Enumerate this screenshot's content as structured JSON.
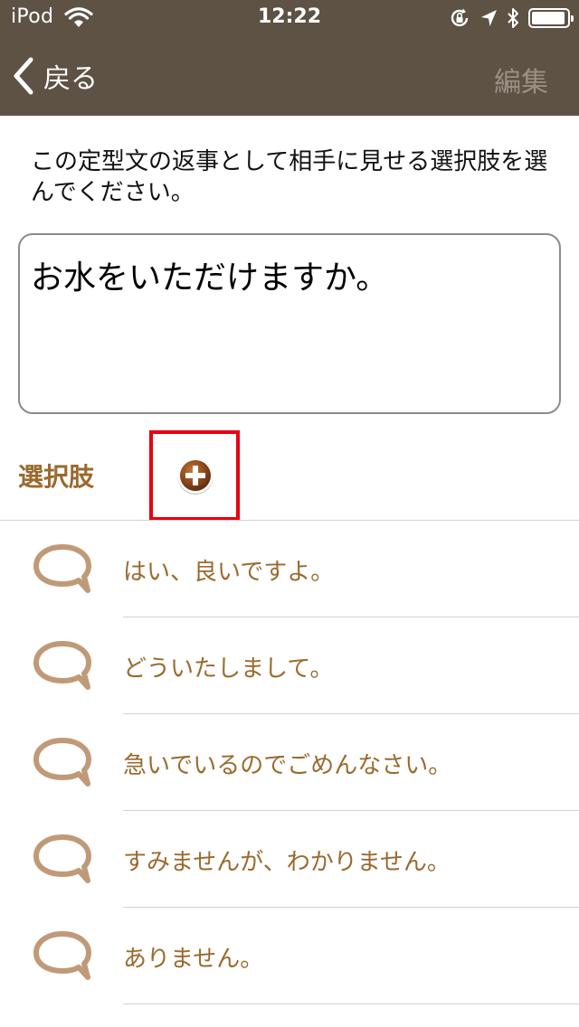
{
  "status_bar": {
    "carrier": "iPod",
    "time": "12:22",
    "icons": [
      "wifi-icon",
      "orientation-lock-icon",
      "location-arrow-icon",
      "bluetooth-icon",
      "battery-icon"
    ],
    "battery_level": 0.95
  },
  "nav": {
    "back_label": "戻る",
    "edit_label": "編集"
  },
  "instruction": "この定型文の返事として相手に見せる選択肢を選んでください。",
  "phrase": "お水をいただけますか。",
  "options": {
    "header": "選択肢",
    "items": [
      {
        "label": "はい、良いですよ。"
      },
      {
        "label": "どういたしまして。"
      },
      {
        "label": "急いでいるのでごめんなさい。"
      },
      {
        "label": "すみませんが、わかりません。"
      },
      {
        "label": "ありません。"
      }
    ]
  },
  "colors": {
    "bar_background": "#5e5245",
    "accent_brown": "#9a6a2e",
    "bubble_color": "#c09a78",
    "highlight_red": "#e8000f",
    "edit_disabled": "#9c9085"
  }
}
